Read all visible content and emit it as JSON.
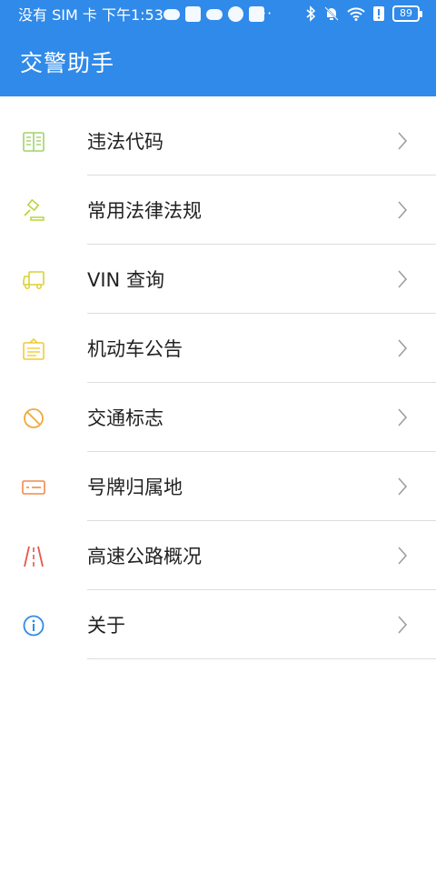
{
  "status_bar": {
    "left_text": "没有 SIM 卡 下午1:53",
    "more": "···",
    "battery": "89"
  },
  "header": {
    "title": "交警助手"
  },
  "menu": {
    "items": [
      {
        "label": "违法代码",
        "icon": "book-icon",
        "color": "#9fd36a"
      },
      {
        "label": "常用法律法规",
        "icon": "gavel-icon",
        "color": "#b7d63f"
      },
      {
        "label": "VIN 查询",
        "icon": "truck-icon",
        "color": "#d9d236"
      },
      {
        "label": "机动车公告",
        "icon": "document-icon",
        "color": "#f1cc35"
      },
      {
        "label": "交通标志",
        "icon": "prohibited-icon",
        "color": "#f0a93c"
      },
      {
        "label": "号牌归属地",
        "icon": "license-plate-icon",
        "color": "#f08a4b"
      },
      {
        "label": "高速公路概况",
        "icon": "highway-icon",
        "color": "#e5574d"
      },
      {
        "label": "关于",
        "icon": "info-icon",
        "color": "#2f8ae9"
      }
    ]
  }
}
